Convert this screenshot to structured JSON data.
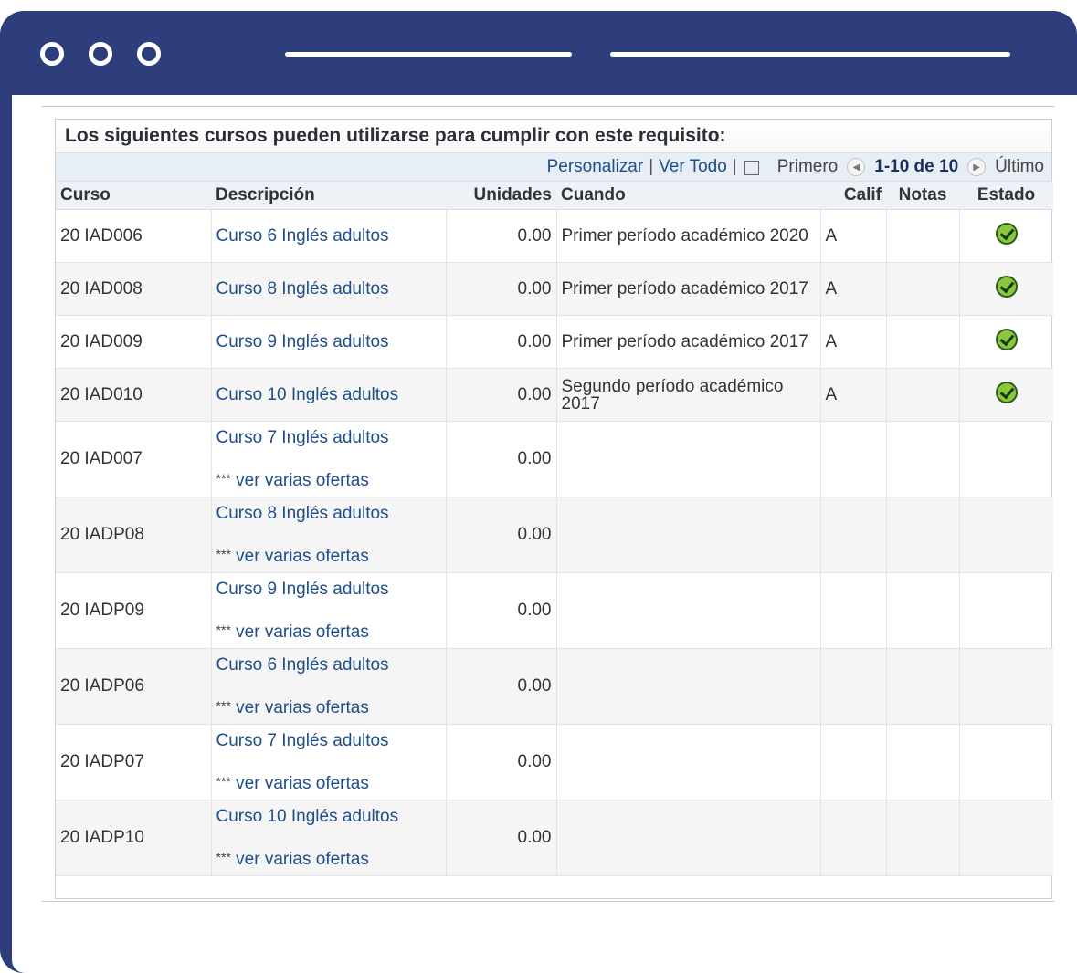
{
  "window": {
    "controls": [
      "circle-icon",
      "circle-icon",
      "circle-icon"
    ]
  },
  "requirement": {
    "title": "Los siguientes cursos pueden utilizarse para cumplir con este requisito:",
    "toolbar": {
      "personalize": "Personalizar",
      "separator": "|",
      "view_all": "Ver Todo",
      "first": "Primero",
      "range": "1-10 de 10",
      "last": "Último"
    },
    "columns": [
      "Curso",
      "Descripción",
      "Unidades",
      "Cuando",
      "Calif",
      "Notas",
      "Estado"
    ],
    "rows": [
      {
        "course": "20 IAD006",
        "description": "Curso 6 Inglés adultos",
        "units": "0.00",
        "when": "Primer período académico 2020",
        "grade": "A",
        "status": "check-icon"
      },
      {
        "course": "20 IAD008",
        "description": "Curso 8 Inglés adultos",
        "units": "0.00",
        "when": "Primer período académico 2017",
        "grade": "A",
        "status": "check-icon"
      },
      {
        "course": "20 IAD009",
        "description": "Curso 9 Inglés adultos",
        "units": "0.00",
        "when": "Primer período académico 2017",
        "grade": "A",
        "status": "check-icon"
      },
      {
        "course": "20 IAD010",
        "description": "Curso 10 Inglés adultos",
        "units": "0.00",
        "when": "Segundo período académico 2017",
        "grade": "A",
        "status": "check-icon"
      },
      {
        "course": "20 IAD007",
        "description": "Curso 7 Inglés adultos",
        "units": "0.00",
        "offers_stars": "***",
        "offers": "ver varias ofertas"
      },
      {
        "course": "20 IADP08",
        "description": "Curso 8 Inglés adultos",
        "units": "0.00",
        "offers_stars": "***",
        "offers": "ver varias ofertas"
      },
      {
        "course": "20 IADP09",
        "description": "Curso 9 Inglés adultos",
        "units": "0.00",
        "offers_stars": "***",
        "offers": "ver varias ofertas"
      },
      {
        "course": "20 IADP06",
        "description": "Curso 6 Inglés adultos",
        "units": "0.00",
        "offers_stars": "***",
        "offers": "ver varias ofertas"
      },
      {
        "course": "20 IADP07",
        "description": "Curso 7 Inglés adultos",
        "units": "0.00",
        "offers_stars": "***",
        "offers": "ver varias ofertas"
      },
      {
        "course": "20 IADP10",
        "description": "Curso 10 Inglés adultos",
        "units": "0.00",
        "offers_stars": "***",
        "offers": "ver varias ofertas"
      }
    ]
  },
  "colors": {
    "frame": "#2e3d7c",
    "link": "#1f4e8a",
    "check": "#8bc63e"
  }
}
